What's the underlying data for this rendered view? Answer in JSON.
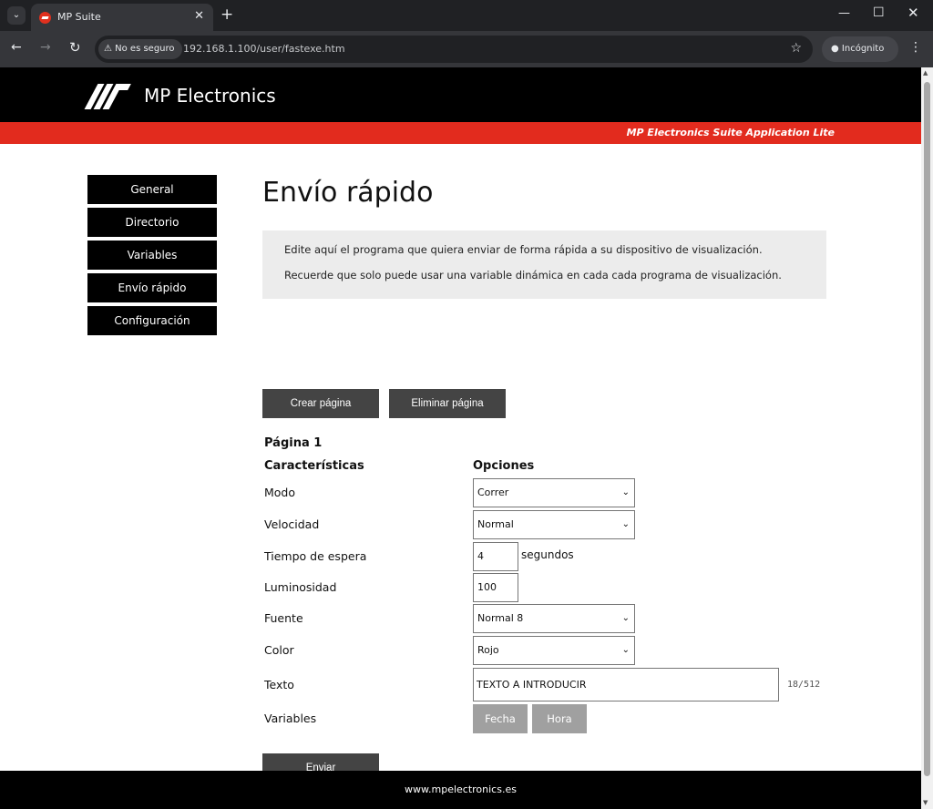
{
  "browser": {
    "tab_title": "MP Suite",
    "tab_close": "✕",
    "new_tab": "+",
    "security_label": "No es seguro",
    "url": "192.168.1.100/user/fastexe.htm",
    "incognito_label": "Incógnito"
  },
  "header": {
    "brand": "MP Electronics",
    "suite_label": "MP Electronics Suite Application Lite"
  },
  "sidebar": {
    "items": [
      {
        "label": "General"
      },
      {
        "label": "Directorio"
      },
      {
        "label": "Variables"
      },
      {
        "label": "Envío rápido"
      },
      {
        "label": "Configuración"
      }
    ]
  },
  "main": {
    "title": "Envío rápido",
    "info_line1": "Edite aquí el programa que quiera enviar de forma rápida a su dispositivo de visualización.",
    "info_line2": "Recuerde que solo puede usar una variable dinámica en cada cada programa de visualización.",
    "create_page_label": "Crear página",
    "delete_page_label": "Eliminar página",
    "page_label": "Página 1",
    "col_characteristics": "Características",
    "col_options": "Opciones",
    "fields": {
      "mode_label": "Modo",
      "mode_value": "Correr",
      "speed_label": "Velocidad",
      "speed_value": "Normal",
      "wait_label": "Tiempo de espera",
      "wait_value": "4",
      "wait_unit": "segundos",
      "brightness_label": "Luminosidad",
      "brightness_value": "100",
      "font_label": "Fuente",
      "font_value": "Normal 8",
      "color_label": "Color",
      "color_value": "Rojo",
      "text_label": "Texto",
      "text_value": "TEXTO A INTRODUCIR",
      "text_counter": "18/512",
      "variables_label": "Variables",
      "date_button": "Fecha",
      "time_button": "Hora"
    },
    "send_label": "Enviar"
  },
  "footer": {
    "site": "www.mpelectronics.es"
  },
  "colors": {
    "accent_red": "#e22b1e",
    "header_black": "#000000",
    "button_dark": "#444444",
    "button_grey": "#a0a0a0"
  }
}
